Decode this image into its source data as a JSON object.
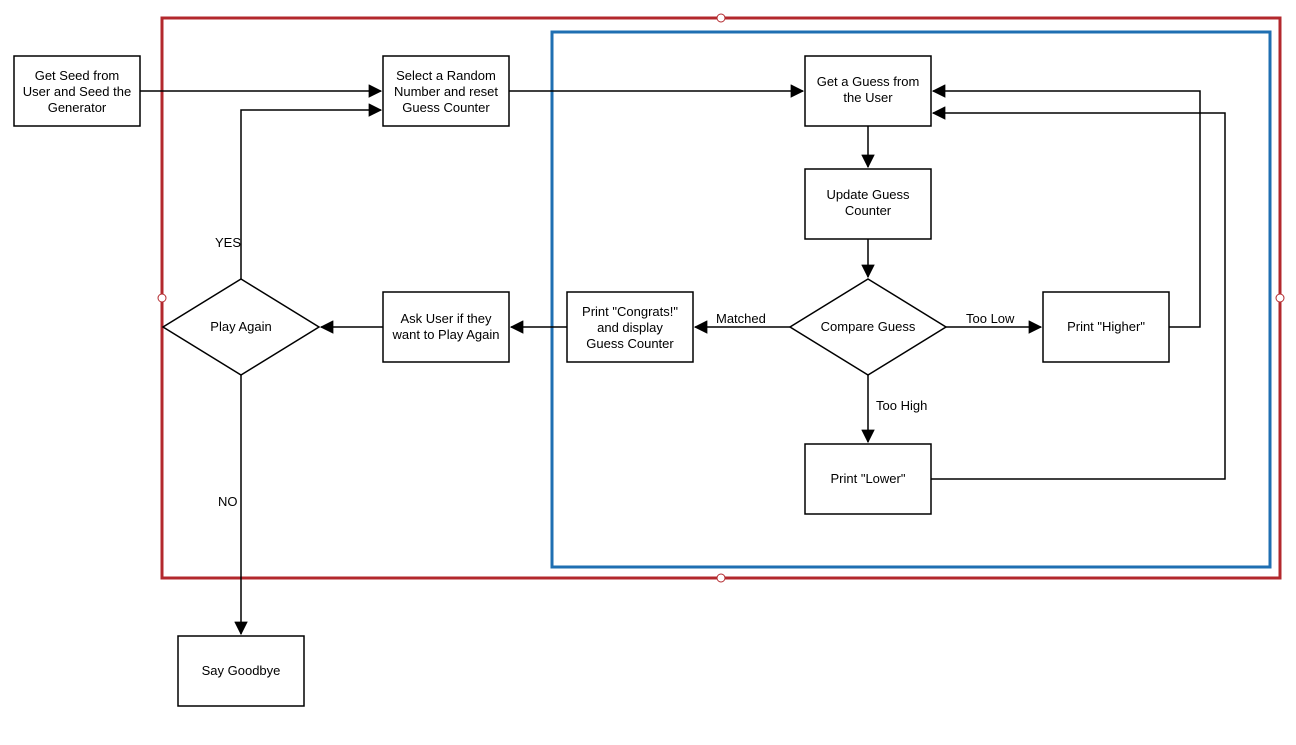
{
  "colors": {
    "red_container": "#b3282d",
    "blue_container": "#1f6fb2",
    "node_stroke": "#000000"
  },
  "nodes": {
    "seed": {
      "lines": [
        "Get Seed from",
        "User and Seed the",
        "Generator"
      ]
    },
    "select": {
      "lines": [
        "Select a Random",
        "Number and reset",
        "Guess Counter"
      ]
    },
    "getguess": {
      "lines": [
        "Get a Guess from",
        "the User"
      ]
    },
    "update": {
      "lines": [
        "Update Guess",
        "Counter"
      ]
    },
    "compare": {
      "lines": [
        "Compare Guess"
      ]
    },
    "higher": {
      "lines": [
        "Print \"Higher\""
      ]
    },
    "lower": {
      "lines": [
        "Print \"Lower\""
      ]
    },
    "congrats": {
      "lines": [
        "Print \"Congrats!\"",
        "and display",
        "Guess Counter"
      ]
    },
    "ask": {
      "lines": [
        "Ask User if they",
        "want to Play Again"
      ]
    },
    "playagain": {
      "lines": [
        "Play Again"
      ]
    },
    "goodbye": {
      "lines": [
        "Say Goodbye"
      ]
    }
  },
  "edges": {
    "yes": "YES",
    "no": "NO",
    "matched": "Matched",
    "toolow": "Too Low",
    "toohigh": "Too High"
  }
}
